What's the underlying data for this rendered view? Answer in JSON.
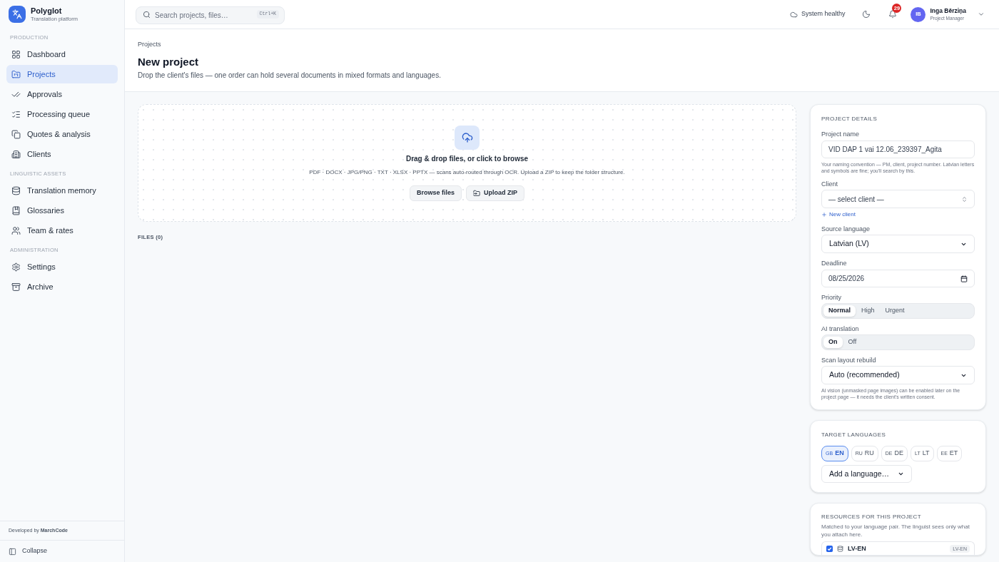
{
  "sidebar": {
    "brand": {
      "name": "Polyglot",
      "tagline": "Translation platform"
    },
    "sections": [
      {
        "heading": "PRODUCTION",
        "items": [
          {
            "label": "Dashboard",
            "selected": false
          },
          {
            "label": "Projects",
            "selected": true
          },
          {
            "label": "Approvals",
            "selected": false
          },
          {
            "label": "Processing queue",
            "selected": false
          },
          {
            "label": "Quotes & analysis",
            "selected": false
          },
          {
            "label": "Clients",
            "selected": false
          }
        ]
      },
      {
        "heading": "LINGUISTIC ASSETS",
        "items": [
          {
            "label": "Translation memory",
            "selected": false
          },
          {
            "label": "Glossaries",
            "selected": false
          },
          {
            "label": "Team & rates",
            "selected": false
          }
        ]
      },
      {
        "heading": "ADMINISTRATION",
        "items": [
          {
            "label": "Settings",
            "selected": false
          },
          {
            "label": "Archive",
            "selected": false
          }
        ]
      }
    ],
    "credit": "Developed by **MarchCode**",
    "collapse": "Collapse"
  },
  "topbar": {
    "search": {
      "placeholder": "Search projects, files…",
      "shortcut": "Ctrl+K"
    },
    "status": "System healthy",
    "notifications": "29",
    "user": {
      "initials": "IB",
      "name": "Inga Bērziņa",
      "role": "Project Manager"
    }
  },
  "header": {
    "breadcrumb": "Projects",
    "title": "New project",
    "subtitle": "Drop the client's files — one order can hold several documents in mixed formats and languages."
  },
  "dropzone": {
    "title": "Drag & drop files, or click to browse",
    "formats": "PDF · DOCX · JPG/PNG · TXT · XLSX · PPTX — scans auto-routed through OCR. Upload a ZIP to keep the folder structure.",
    "buttons": [
      {
        "label": "Browse files",
        "kind": "plain"
      },
      {
        "label": "Upload ZIP",
        "kind": "folder"
      }
    ]
  },
  "files": {
    "heading": "FILES (0)"
  },
  "project_details": {
    "heading": "PROJECT DETAILS",
    "fields": [
      {
        "kind": "text",
        "label": "Project name",
        "value": "VID DAP 1 vai 12.06_239397_Agita",
        "hint": "Your naming convention — PM, client, project number. Latvian letters and symbols are fine; you'll search by this."
      },
      {
        "kind": "combobox",
        "label": "Client",
        "value": "— select client —",
        "link": "New client"
      },
      {
        "kind": "select",
        "label": "Source language",
        "value": "Latvian (LV)"
      },
      {
        "kind": "date",
        "label": "Deadline",
        "value": "08/25/2026"
      },
      {
        "kind": "segmented",
        "label": "Priority",
        "options": [
          {
            "label": "Normal",
            "selected": true
          },
          {
            "label": "High",
            "selected": false
          },
          {
            "label": "Urgent",
            "selected": false
          }
        ]
      },
      {
        "kind": "segmented",
        "label": "AI translation",
        "options": [
          {
            "label": "On",
            "selected": true
          },
          {
            "label": "Off",
            "selected": false
          }
        ]
      },
      {
        "kind": "select",
        "label": "Scan layout rebuild",
        "value": "Auto (recommended)",
        "hint": "AI vision (unmasked page images) can be enabled later on the project page — it needs the client's written consent."
      }
    ]
  },
  "target_languages": {
    "heading": "TARGET LANGUAGES",
    "languages": [
      {
        "country": "GB",
        "code": "EN",
        "selected": true
      },
      {
        "country": "RU",
        "code": "RU",
        "selected": false
      },
      {
        "country": "DE",
        "code": "DE",
        "selected": false
      },
      {
        "country": "LT",
        "code": "LT",
        "selected": false
      },
      {
        "country": "EE",
        "code": "ET",
        "selected": false
      }
    ],
    "add": "Add a language…"
  },
  "resources": {
    "heading": "RESOURCES FOR THIS PROJECT",
    "description": "Matched to your language pair. The linguist sees only what you attach here.",
    "items": [
      {
        "checked": true,
        "label": "LV-EN",
        "badge": "LV-EN"
      }
    ]
  }
}
